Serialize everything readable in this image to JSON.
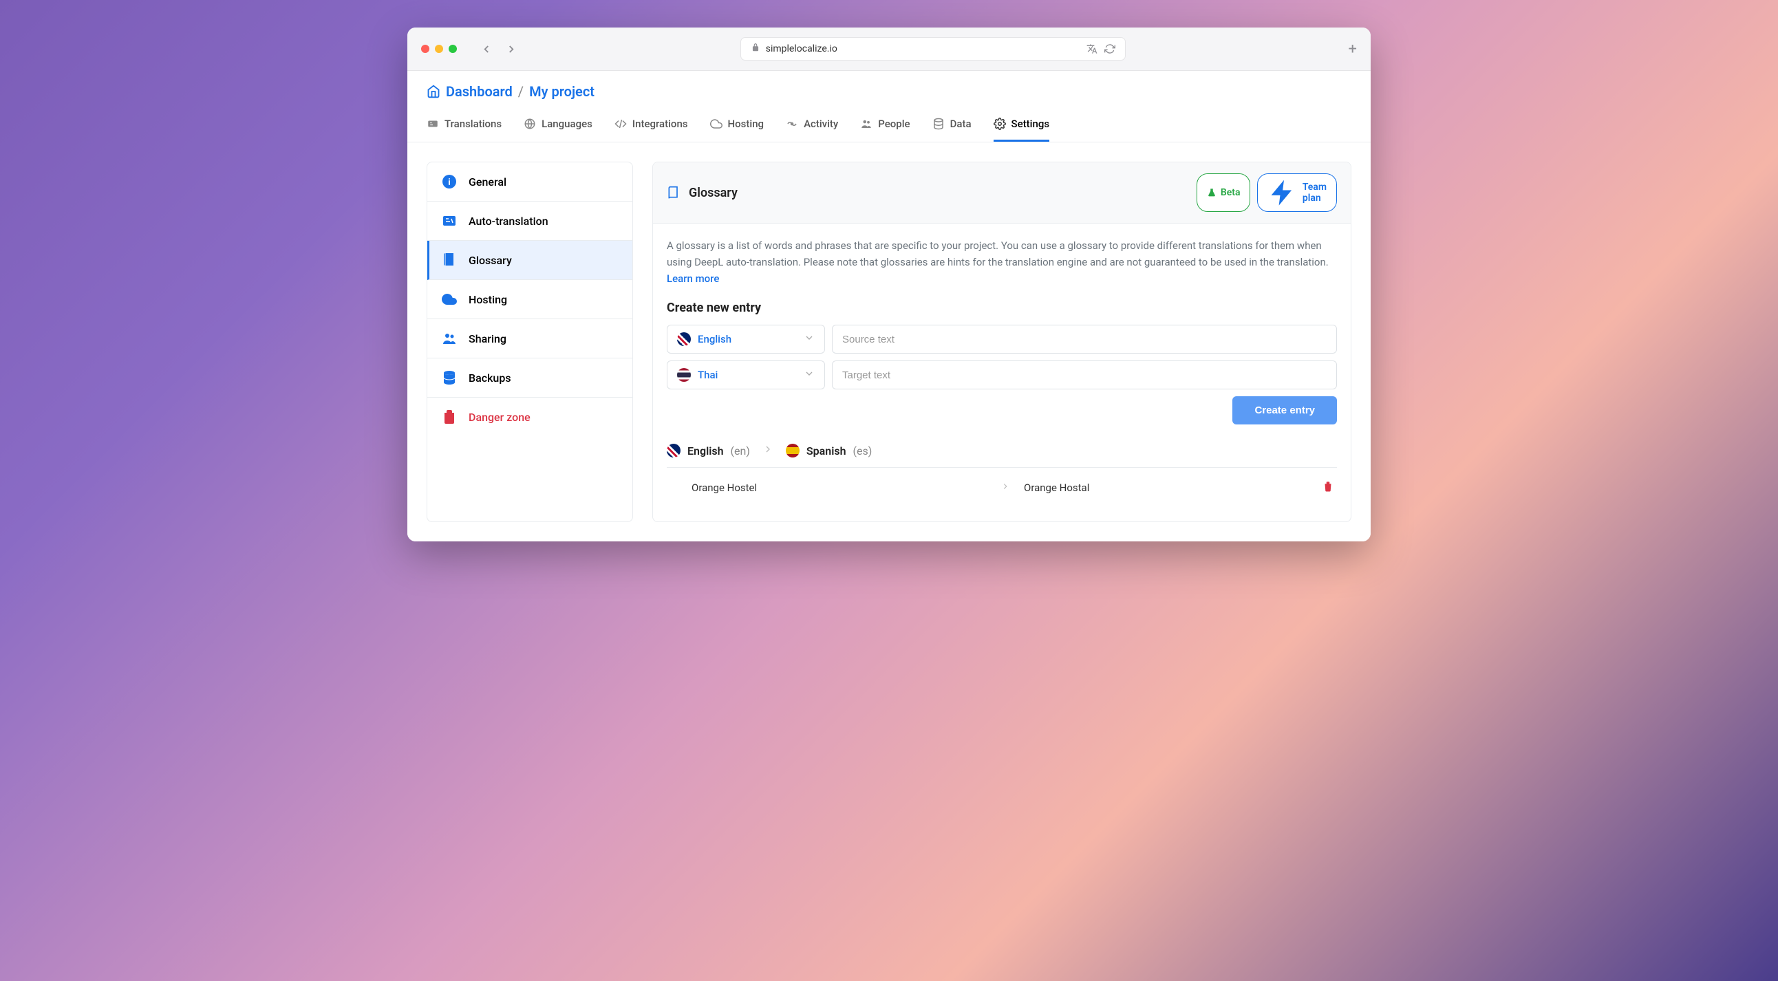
{
  "browser": {
    "url": "simplelocalize.io"
  },
  "breadcrumb": {
    "root": "Dashboard",
    "current": "My project"
  },
  "tabs": [
    {
      "label": "Translations"
    },
    {
      "label": "Languages"
    },
    {
      "label": "Integrations"
    },
    {
      "label": "Hosting"
    },
    {
      "label": "Activity"
    },
    {
      "label": "People"
    },
    {
      "label": "Data"
    },
    {
      "label": "Settings",
      "active": true
    }
  ],
  "sidebar": {
    "items": [
      {
        "label": "General"
      },
      {
        "label": "Auto-translation"
      },
      {
        "label": "Glossary",
        "active": true
      },
      {
        "label": "Hosting"
      },
      {
        "label": "Sharing"
      },
      {
        "label": "Backups"
      },
      {
        "label": "Danger zone",
        "danger": true
      }
    ]
  },
  "panel": {
    "title": "Glossary",
    "badges": {
      "beta": "Beta",
      "team": "Team plan"
    },
    "description": "A glossary is a list of words and phrases that are specific to your project. You can use a glossary to provide different translations for them when using DeepL auto-translation. Please note that glossaries are hints for the translation engine and are not guaranteed to be used in the translation.",
    "learn_more": "Learn more",
    "create_heading": "Create new entry",
    "lang_source": "English",
    "lang_target": "Thai",
    "placeholder_source": "Source text",
    "placeholder_target": "Target text",
    "create_button": "Create entry",
    "entries_header": {
      "source_lang": "English",
      "source_code": "(en)",
      "target_lang": "Spanish",
      "target_code": "(es)"
    },
    "entries": [
      {
        "source": "Orange Hostel",
        "target": "Orange Hostal"
      }
    ]
  }
}
